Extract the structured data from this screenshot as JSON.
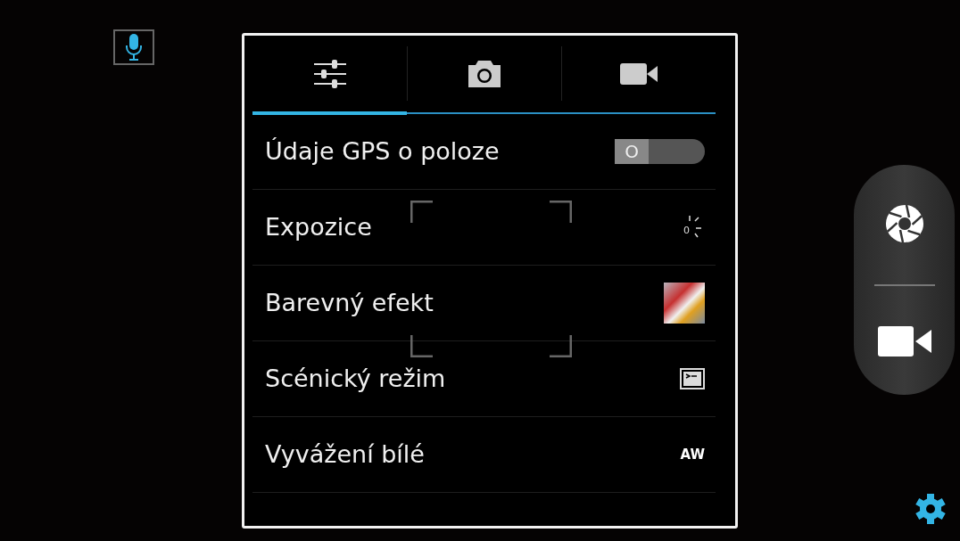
{
  "tabs": [
    {
      "kind": "sliders",
      "selected": true
    },
    {
      "kind": "camera",
      "selected": false
    },
    {
      "kind": "video",
      "selected": false
    }
  ],
  "settings": [
    {
      "label": "Údaje GPS o poloze",
      "kind": "toggle",
      "on": false,
      "value_text": "O"
    },
    {
      "label": "Expozice",
      "kind": "exposure",
      "value_text": "0"
    },
    {
      "label": "Barevný efekt",
      "kind": "effect"
    },
    {
      "label": "Scénický režim",
      "kind": "scene"
    },
    {
      "label": "Vyvážení bílé",
      "kind": "wb",
      "value_text": "AW"
    }
  ],
  "mode_switch": [
    {
      "kind": "shutter"
    },
    {
      "kind": "video"
    }
  ]
}
